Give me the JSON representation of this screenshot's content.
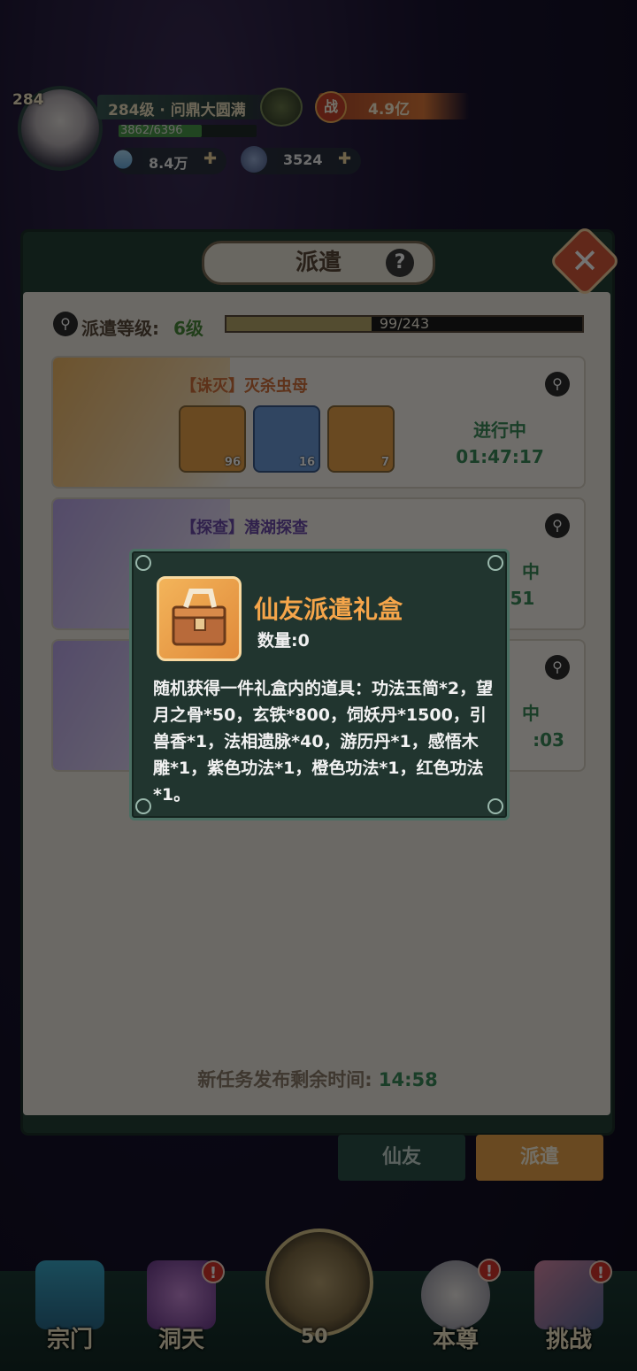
{
  "player": {
    "avatar_level": "284",
    "name": "284级 · 问鼎大圆满",
    "exp": "3862/6396",
    "exp_fraction": 0.604,
    "power_icon": "战",
    "power": "4.9亿",
    "diamond": "8.4万",
    "coin": "3524"
  },
  "panel": {
    "title": "派遣",
    "level_label": "派遣等级:",
    "level_value": "6级",
    "level_progress": "99/243",
    "level_fraction": 0.407
  },
  "missions": [
    {
      "title": "【诛灭】灭杀虫母",
      "items": [
        "96",
        "16",
        "7"
      ],
      "status": "进行中",
      "timer": "01:47:17"
    },
    {
      "title": "【探查】潜湖探查",
      "status": "中",
      "timer": "00:  :51"
    },
    {
      "status": "中",
      "timer": ":03"
    }
  ],
  "bottom": {
    "label": "新任务发布剩余时间:",
    "time": "14:58",
    "tabs": [
      "仙友",
      "派遣"
    ]
  },
  "nav": [
    "宗门",
    "洞天",
    "本尊",
    "挑战"
  ],
  "orb_count": "50",
  "tooltip": {
    "name": "仙友派遣礼盒",
    "quantity": "数量:0",
    "description": "随机获得一件礼盒内的道具：功法玉简*2，望月之骨*50，玄铁*800，饲妖丹*1500，引兽香*1，法相遗脉*40，游历丹*1，感悟木雕*1，紫色功法*1，橙色功法*1，红色功法*1。"
  },
  "colors": {
    "accent_green": "#3a8a5a",
    "orange": "#f5a54a",
    "panel_dark": "#244036"
  }
}
